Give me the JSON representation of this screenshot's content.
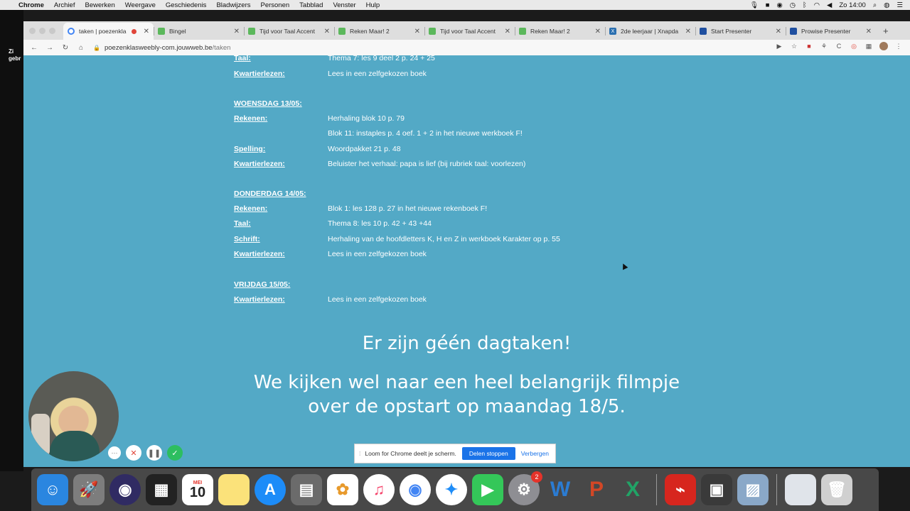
{
  "menubar": {
    "items": [
      "Chrome",
      "Archief",
      "Bewerken",
      "Weergave",
      "Geschiedenis",
      "Bladwijzers",
      "Personen",
      "Tabblad",
      "Venster",
      "Hulp"
    ],
    "clock": "Zo 14:00"
  },
  "desktop": {
    "label_1": "Zi",
    "label_2": "gebr"
  },
  "tabs": [
    {
      "title": "taken | poezenkla",
      "favicon_color": "#e8e8e8"
    },
    {
      "title": "Bingel",
      "favicon_color": "#4caf50"
    },
    {
      "title": "Tijd voor Taal Accent",
      "favicon_color": "#5cb85c"
    },
    {
      "title": "Reken Maar! 2",
      "favicon_color": "#5cb85c"
    },
    {
      "title": "Tijd voor Taal Accent",
      "favicon_color": "#5cb85c"
    },
    {
      "title": "Reken Maar! 2",
      "favicon_color": "#5cb85c"
    },
    {
      "title": "2de leerjaar | Xnapda",
      "favicon_color": "#2a6fb0"
    },
    {
      "title": "Start Presenter",
      "favicon_color": "#1f4fa0"
    },
    {
      "title": "Prowise Presenter",
      "favicon_color": "#1f4fa0"
    }
  ],
  "address": {
    "host": "poezenklasweebly-com.jouwweb.be",
    "path": "/taken"
  },
  "schedule": {
    "top_row_1": {
      "label": "Taal:",
      "value": "Thema 7: les 9 deel 2 p. 24 + 25"
    },
    "top_row_2": {
      "label": "Kwartierlezen:",
      "value": "Lees in een zelfgekozen boek"
    },
    "wednesday": {
      "day": "WOENSDAG 13/05:",
      "rows": [
        {
          "label": "Rekenen:",
          "value": "Herhaling blok 10 p. 79"
        },
        {
          "label": "",
          "value": "Blok 11: instaples p. 4 oef. 1 + 2 in het nieuwe werkboek F!"
        },
        {
          "label": "Spelling:",
          "value": "Woordpakket 21 p. 48"
        },
        {
          "label": "Kwartierlezen:",
          "value": "Beluister het verhaal: papa is lief (bij rubriek taal: voorlezen)"
        }
      ]
    },
    "thursday": {
      "day": "DONDERDAG 14/05:",
      "rows": [
        {
          "label": "Rekenen:",
          "value": "Blok 1: les 128 p. 27 in het nieuwe rekenboek F!"
        },
        {
          "label": "Taal:",
          "value": "Thema 8: les 10 p. 42 + 43 +44"
        },
        {
          "label": "Schrift:",
          "value": "Herhaling van de hoofdletters K, H en Z in werkboek Karakter op p. 55"
        },
        {
          "label": "Kwartierlezen:",
          "value": "Lees in een zelfgekozen boek"
        }
      ]
    },
    "friday": {
      "day": "VRIJDAG 15/05:",
      "rows": [
        {
          "label": "Kwartierlezen:",
          "value": "Lees in een zelfgekozen boek"
        }
      ]
    }
  },
  "announcement": {
    "line1": "Er zijn géén dagtaken!",
    "line2": "We kijken wel naar een heel belangrijk filmpje",
    "line3": "over de opstart op maandag 18/5."
  },
  "loom": {
    "message": "Loom for Chrome deelt je scherm.",
    "stop_label": "Delen stoppen",
    "hide_label": "Verbergen"
  },
  "dock": {
    "calendar_month": "MEI",
    "calendar_day": "10",
    "settings_badge": "2"
  }
}
